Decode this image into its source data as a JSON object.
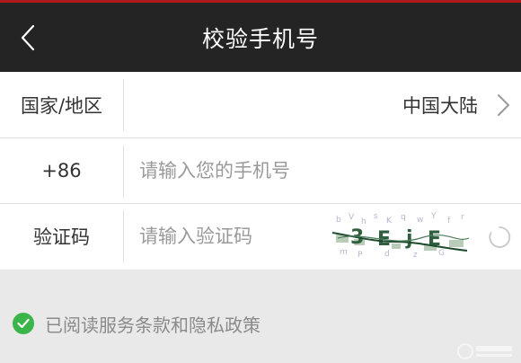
{
  "header": {
    "title": "校验手机号",
    "back_icon": "chevron-left-icon"
  },
  "form": {
    "region": {
      "label": "国家/地区",
      "value": "中国大陆",
      "icon": "chevron-right-icon"
    },
    "phone": {
      "prefix": "+86",
      "value": "",
      "placeholder": "请输入您的手机号"
    },
    "verification": {
      "label": "验证码",
      "value": "",
      "placeholder": "请输入验证码",
      "captcha_text": "3 E j E",
      "refresh_icon": "refresh-icon"
    }
  },
  "agreement": {
    "checked": true,
    "text": "已阅读服务条款和隐私政策"
  },
  "colors": {
    "header_bg": "#242424",
    "header_accent": "#b11a1d",
    "check_green": "#3ab549",
    "placeholder": "#9a9a9a"
  }
}
